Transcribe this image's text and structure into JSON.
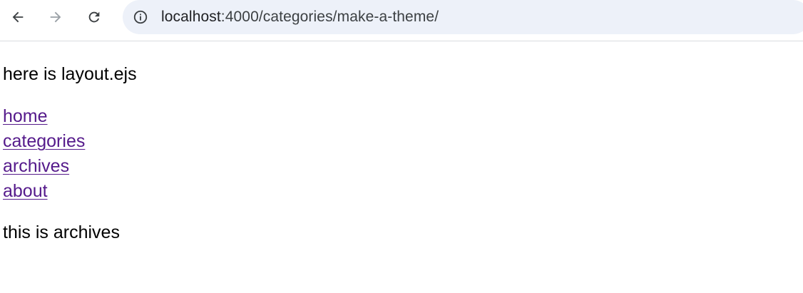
{
  "browser": {
    "url_host": "localhost",
    "url_path": ":4000/categories/make-a-theme/",
    "icons": {
      "back": "arrow-left-icon",
      "forward": "arrow-right-icon",
      "reload": "reload-icon",
      "site_info": "info-icon"
    }
  },
  "page": {
    "layout_text": "here is layout.ejs",
    "nav_links": [
      {
        "label": "home"
      },
      {
        "label": "categories"
      },
      {
        "label": "archives"
      },
      {
        "label": "about"
      }
    ],
    "body_text": "this is archives"
  },
  "colors": {
    "visited_link": "#551a8b",
    "omnibox_bg": "#edf1f9"
  }
}
